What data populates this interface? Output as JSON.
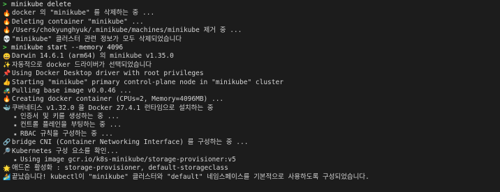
{
  "terminal": {
    "lines": [
      {
        "kind": "prompt",
        "icon": ">",
        "text": "minikube delete"
      },
      {
        "kind": "out",
        "icon": "fire-icon",
        "glyph": "🔥",
        "text": "docker 의 \"minikube\" 를 삭제하는 중 ..."
      },
      {
        "kind": "out",
        "icon": "fire-icon",
        "glyph": "🔥",
        "text": "Deleting container \"minikube\" ..."
      },
      {
        "kind": "out",
        "icon": "fire-icon",
        "glyph": "🔥",
        "text": "/Users/chokyunghyuk/.minikube/machines/minikube 제거 중 ..."
      },
      {
        "kind": "out",
        "icon": "skull-icon",
        "glyph": "💀",
        "text": "\"minikube\" 클러스터 관련 정보가 모두 삭제되었습니다"
      },
      {
        "kind": "prompt",
        "icon": ">",
        "text": "minikube start --memory 4096"
      },
      {
        "kind": "out",
        "icon": "smile-icon",
        "glyph": "😀",
        "text": "Darwin 14.6.1 (arm64) 의 minikube v1.35.0"
      },
      {
        "kind": "out",
        "icon": "sparkles-icon",
        "glyph": "✨",
        "text": "자동적으로 docker 드라이버가 선택되었습니다"
      },
      {
        "kind": "out",
        "icon": "pin-icon",
        "glyph": "📌",
        "text": "Using Docker Desktop driver with root privileges"
      },
      {
        "kind": "out",
        "icon": "thumbs-up-icon",
        "glyph": "👍",
        "text": "Starting \"minikube\" primary control-plane node in \"minikube\" cluster"
      },
      {
        "kind": "out",
        "icon": "tractor-icon",
        "glyph": "🚜",
        "text": "Pulling base image v0.0.46 ..."
      },
      {
        "kind": "out",
        "icon": "fire-icon",
        "glyph": "🔥",
        "text": "Creating docker container (CPUs=2, Memory=4096MB) ..."
      },
      {
        "kind": "out",
        "icon": "whale-icon",
        "glyph": "🐳",
        "text": "쿠버네티스 v1.32.0 을 Docker 27.4.1 런타임으로 설치하는 중"
      },
      {
        "kind": "sub",
        "icon": "bullet-icon",
        "glyph": "▪",
        "text": "인증서 및 키를 생성하는 중 ..."
      },
      {
        "kind": "sub",
        "icon": "bullet-icon",
        "glyph": "▪",
        "text": "컨트롤 플레인을 부팅하는 중 ..."
      },
      {
        "kind": "sub",
        "icon": "bullet-icon",
        "glyph": "▪",
        "text": "RBAC 규칙을 구성하는 중 ..."
      },
      {
        "kind": "out",
        "icon": "link-icon",
        "glyph": "🔗",
        "text": "bridge CNI (Container Networking Interface) 를 구성하는 중 ..."
      },
      {
        "kind": "out",
        "icon": "search-icon",
        "glyph": "🔎",
        "text": "Kubernetes 구성 요소를 확인..."
      },
      {
        "kind": "sub",
        "icon": "bullet-icon",
        "glyph": "▪",
        "text": "Using image gcr.io/k8s-minikube/storage-provisioner:v5"
      },
      {
        "kind": "out",
        "icon": "star-icon",
        "glyph": "🌟",
        "text": "애드온 활성화 : storage-provisioner, default-storageclass"
      },
      {
        "kind": "out",
        "icon": "flag-icon",
        "glyph": "🏄",
        "text": "끝났습니다! kubectl이 \"minikube\" 클러스터와 \"default\" 네임스페이스를 기본적으로 사용하도록 구성되었습니다."
      }
    ]
  }
}
